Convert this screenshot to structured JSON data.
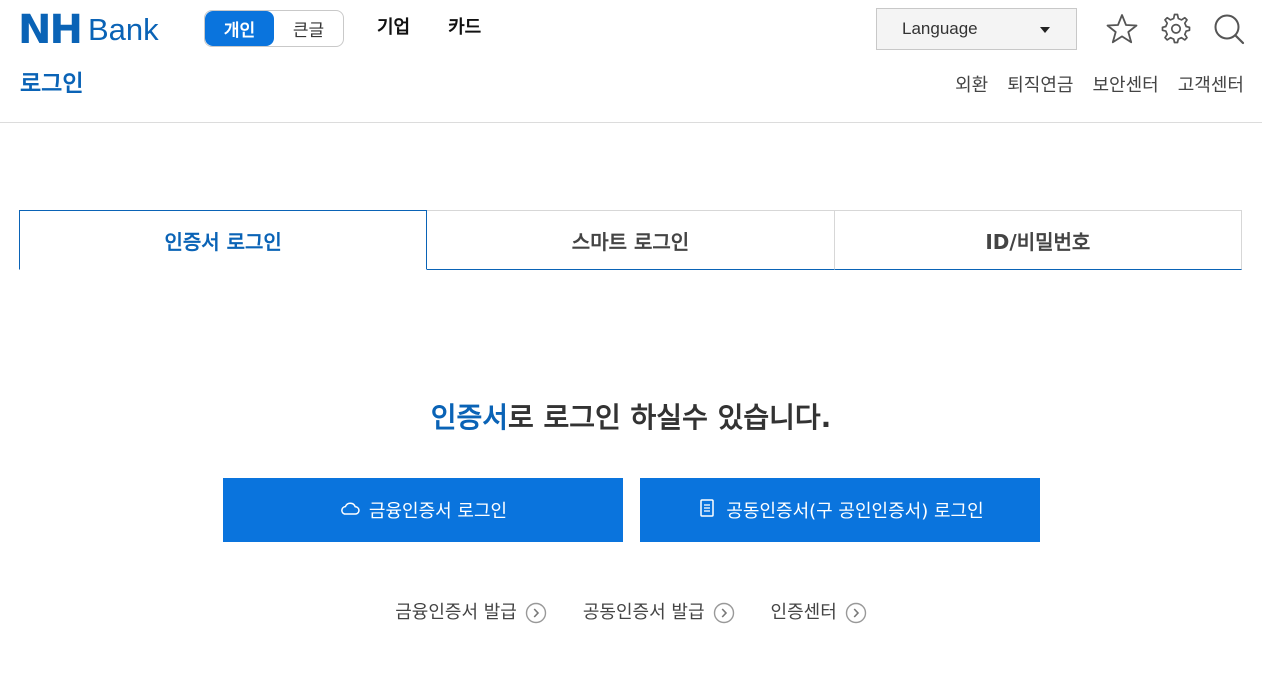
{
  "brand": {
    "nh": "NH",
    "bank": "Bank"
  },
  "segment": {
    "items": [
      {
        "label": "개인",
        "active": true
      },
      {
        "label": "큰글",
        "active": false
      }
    ]
  },
  "topnav": {
    "items": [
      "기업",
      "카드"
    ]
  },
  "language": {
    "label": "Language"
  },
  "icons": {
    "favorite": "star-icon",
    "settings": "gear-icon",
    "search": "search-icon"
  },
  "page": {
    "title": "로그인"
  },
  "subnav": {
    "items": [
      "외환",
      "퇴직연금",
      "보안센터",
      "고객센터"
    ]
  },
  "tabs": {
    "items": [
      {
        "label": "인증서 로그인",
        "active": true
      },
      {
        "label": "스마트 로그인",
        "active": false
      },
      {
        "label": "ID/비밀번호",
        "active": false
      }
    ]
  },
  "main": {
    "headline_highlight": "인증서",
    "headline_rest": "로 로그인 하실수 있습니다.",
    "buttons": [
      {
        "label": "금융인증서 로그인",
        "icon": "cloud-icon"
      },
      {
        "label": "공동인증서(구 공인인증서) 로그인",
        "icon": "document-icon"
      }
    ],
    "links": [
      "금융인증서 발급",
      "공동인증서 발급",
      "인증센터"
    ]
  },
  "colors": {
    "brand_blue": "#0a63b6",
    "button_blue": "#0a74dd"
  }
}
